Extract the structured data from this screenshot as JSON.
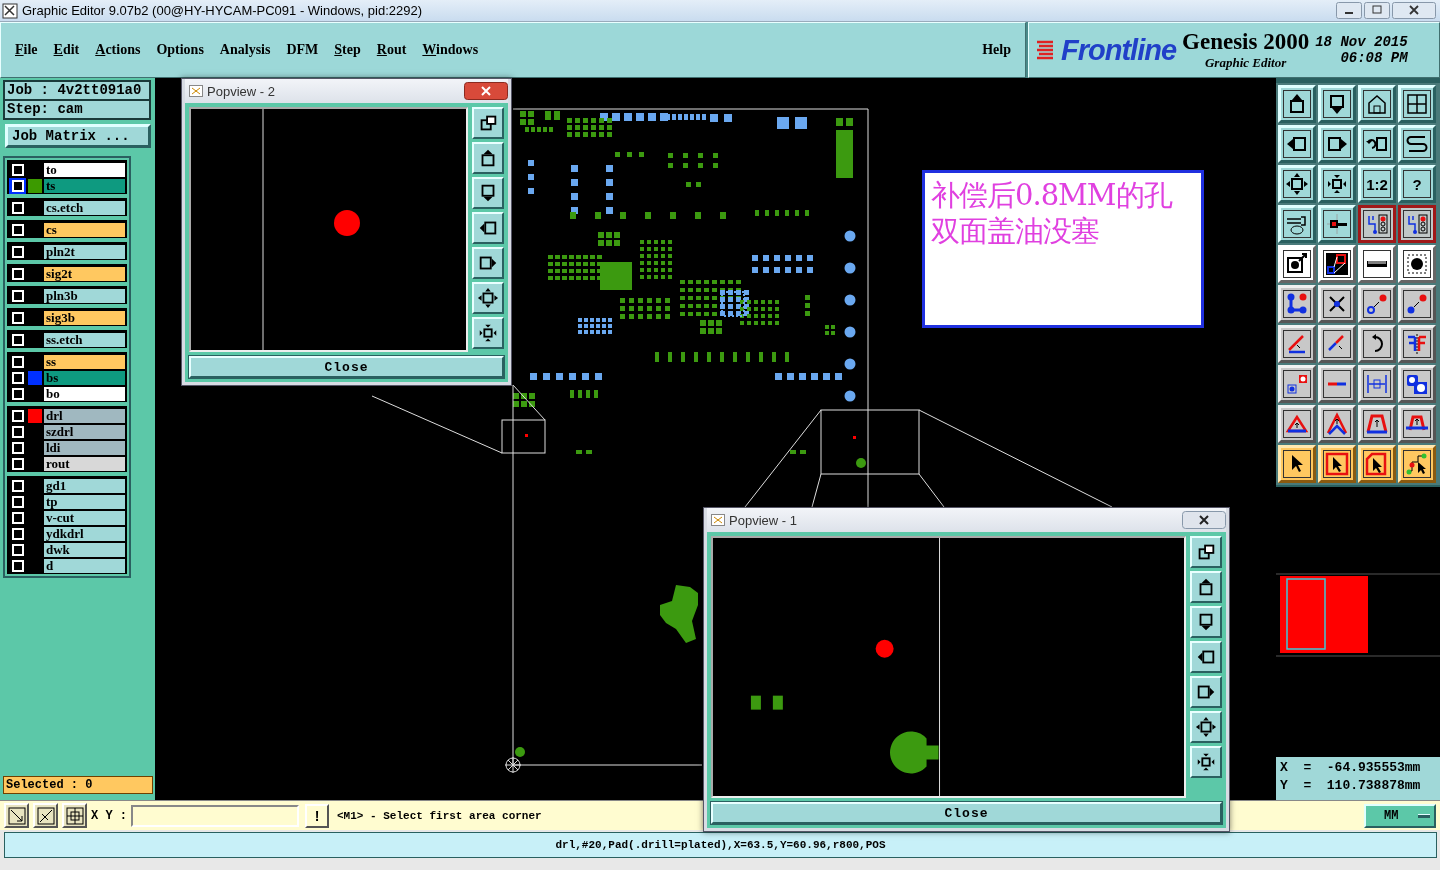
{
  "window": {
    "title": "Graphic Editor 9.07b2 (00@HY-HYCAM-PC091 - Windows, pid:2292)"
  },
  "menu": [
    {
      "label": "File",
      "mnemonic": true
    },
    {
      "label": "Edit",
      "mnemonic": true
    },
    {
      "label": "Actions",
      "mnemonic": true
    },
    {
      "label": "Options",
      "mnemonic": false
    },
    {
      "label": "Analysis",
      "mnemonic": false
    },
    {
      "label": "DFM",
      "mnemonic": false
    },
    {
      "label": "Step",
      "mnemonic": true
    },
    {
      "label": "Rout",
      "mnemonic": true
    },
    {
      "label": "Windows",
      "mnemonic": true
    }
  ],
  "help": "Help",
  "brand": {
    "logo": "Frontline",
    "product": "Genesis 2000",
    "subtitle": "Graphic Editor",
    "date": "18 Nov 2015",
    "time": "06:08 PM"
  },
  "job": "Job : 4v2tt091a0",
  "step": "Step: cam",
  "job_matrix": "Job Matrix ...",
  "layer_groups": [
    {
      "layers": [
        {
          "name": "to",
          "selected": false,
          "color": "#ffffff"
        },
        {
          "name": "ts",
          "selected": false,
          "active": true,
          "color": "#0e9a80",
          "swatch": {
            "color": "#3c9a00"
          }
        }
      ]
    },
    {
      "layers": [
        {
          "name": "cs.etch",
          "selected": false,
          "color": "#a0d8d8"
        }
      ]
    },
    {
      "layers": [
        {
          "name": "cs",
          "selected": false,
          "color": "#ffc860"
        }
      ]
    },
    {
      "layers": [
        {
          "name": "pln2t",
          "selected": false,
          "color": "#a0d8d8"
        }
      ]
    },
    {
      "layers": [
        {
          "name": "sig2t",
          "selected": false,
          "color": "#ffc860"
        }
      ]
    },
    {
      "layers": [
        {
          "name": "pln3b",
          "selected": false,
          "color": "#a0d8d8"
        }
      ]
    },
    {
      "layers": [
        {
          "name": "sig3b",
          "selected": false,
          "color": "#ffc860"
        }
      ]
    },
    {
      "layers": [
        {
          "name": "ss.etch",
          "selected": false,
          "color": "#a0d8d8"
        }
      ]
    },
    {
      "layers": [
        {
          "name": "ss",
          "selected": false,
          "color": "#ffc860"
        },
        {
          "name": "bs",
          "selected": false,
          "color": "#0e9a80",
          "swatch": {
            "color": "#0030ff"
          }
        },
        {
          "name": "bo",
          "selected": false,
          "color": "#ffffff"
        }
      ]
    },
    {
      "layers": [
        {
          "name": "drl",
          "selected": false,
          "color": "#a0b8c0",
          "swatch": {
            "color": "#ff0000"
          }
        },
        {
          "name": "szdrl",
          "selected": false,
          "color": "#a0b8c0"
        },
        {
          "name": "ldi",
          "selected": false,
          "color": "#a0b8c0"
        },
        {
          "name": "rout",
          "selected": false,
          "color": "#d8d8d8"
        }
      ]
    },
    {
      "layers": [
        {
          "name": "gd1",
          "selected": false,
          "color": "#a0d8d8"
        },
        {
          "name": "tp",
          "selected": false,
          "color": "#a0d8d8"
        },
        {
          "name": "v-cut",
          "selected": false,
          "color": "#a0d8d8"
        },
        {
          "name": "ydkdrl",
          "selected": false,
          "color": "#a0d8d8"
        },
        {
          "name": "dwk",
          "selected": false,
          "color": "#a0d8d8"
        },
        {
          "name": "d",
          "selected": false,
          "color": "#a0d8d8"
        }
      ]
    }
  ],
  "selected_count": "Selected : 0",
  "note": {
    "lines": [
      "补偿后0.8MM的孔",
      "双面盖油没塞"
    ]
  },
  "popviews": [
    {
      "title": "Popview - 2",
      "button": "Close",
      "active": true,
      "kind": "single-hole"
    },
    {
      "title": "Popview - 1",
      "button": "Close",
      "active": false,
      "kind": "hole-and-pads"
    }
  ],
  "toolbar": [
    {
      "kind": "box-arrow-up",
      "selected": false
    },
    {
      "kind": "box-arrow-down",
      "selected": false
    },
    {
      "kind": "house",
      "selected": false
    },
    {
      "kind": "grid-window",
      "selected": false
    },
    {
      "kind": "box-arrow-left",
      "selected": false
    },
    {
      "kind": "box-arrow-right",
      "selected": false
    },
    {
      "kind": "undo-box",
      "selected": false
    },
    {
      "kind": "s-curve",
      "selected": false
    },
    {
      "kind": "expand-box",
      "selected": false
    },
    {
      "kind": "shrink-box",
      "selected": false
    },
    {
      "kind": "text",
      "label": "1:2",
      "selected": false
    },
    {
      "kind": "text",
      "label": "?",
      "selected": false
    },
    {
      "kind": "tools",
      "selected": false
    },
    {
      "kind": "probe",
      "selected": false
    },
    {
      "kind": "circuit",
      "selected": true
    },
    {
      "kind": "circuit",
      "selected": true
    },
    {
      "kind": "dot-arrow",
      "selected": false
    },
    {
      "kind": "snap-squares",
      "selected": false
    },
    {
      "kind": "ruler",
      "selected": false
    },
    {
      "kind": "dashed-dot",
      "selected": false
    },
    {
      "kind": "connected-dots",
      "selected": false
    },
    {
      "kind": "cross-dot",
      "selected": false
    },
    {
      "kind": "hollow-dot-arrow",
      "selected": false
    },
    {
      "kind": "solid-dot-arrow",
      "selected": false
    },
    {
      "kind": "angle-line",
      "selected": false
    },
    {
      "kind": "diagonal-line",
      "selected": false
    },
    {
      "kind": "rotate",
      "selected": false
    },
    {
      "kind": "mirror",
      "selected": false
    },
    {
      "kind": "square-dot-arrow",
      "selected": false
    },
    {
      "kind": "split-line",
      "selected": false
    },
    {
      "kind": "measure",
      "selected": false
    },
    {
      "kind": "blue-shapes",
      "selected": false
    },
    {
      "kind": "triangle",
      "selected": false
    },
    {
      "kind": "chevron",
      "selected": false
    },
    {
      "kind": "arch",
      "selected": false
    },
    {
      "kind": "arch-line",
      "selected": false
    },
    {
      "kind": "pointer",
      "selected": false
    },
    {
      "kind": "pointer-box",
      "selected": false
    },
    {
      "kind": "pointer-cut",
      "selected": false
    },
    {
      "kind": "pointer-path",
      "selected": false
    }
  ],
  "coords": {
    "x": "X  =  -64.935553mm",
    "y": "Y  =  110.738878mm"
  },
  "command": {
    "xy_label": "X Y :",
    "alert": "!",
    "message": "<M1> - Select first area corner",
    "units": "MM"
  },
  "status": "drl,#20,Pad(.drill=plated),X=63.5,Y=60.96,r800,POS"
}
